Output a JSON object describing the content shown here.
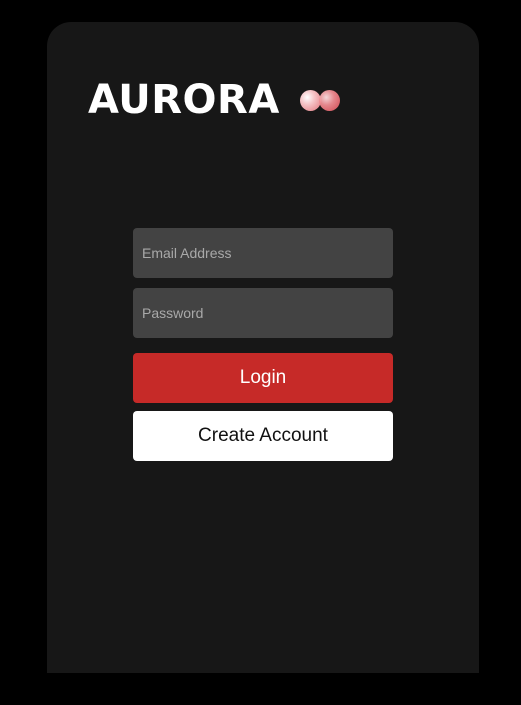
{
  "brand": {
    "title": "AURORA",
    "logo_icon": "two-dots-logo-icon"
  },
  "form": {
    "email": {
      "placeholder": "Email Address",
      "value": ""
    },
    "password": {
      "placeholder": "Password",
      "value": ""
    },
    "login_label": "Login",
    "create_account_label": "Create Account"
  },
  "colors": {
    "page_background": "#000000",
    "card_background": "#171717",
    "input_background": "#434343",
    "login_button": "#c62a28",
    "create_button": "#ffffff"
  }
}
